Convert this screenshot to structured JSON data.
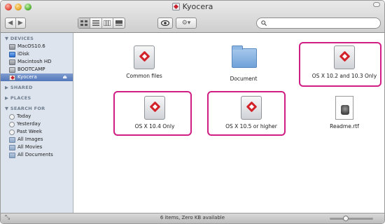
{
  "window": {
    "title": "Kyocera"
  },
  "toolbar": {
    "back_glyph": "◀",
    "forward_glyph": "▶",
    "view_modes": [
      "icon-view",
      "list-view",
      "column-view",
      "coverflow-view"
    ],
    "quick_look_glyph": "👁",
    "action_glyph": "⚙▾",
    "search_placeholder": ""
  },
  "sidebar": {
    "sections": [
      {
        "label": "▼ DEVICES"
      },
      {
        "label": "▶ SHARED"
      },
      {
        "label": "▶ PLACES"
      },
      {
        "label": "▼ SEARCH FOR"
      }
    ],
    "devices": [
      {
        "label": "MacOS10.6",
        "icon": "hard-drive-icon"
      },
      {
        "label": "iDisk",
        "icon": "idisk-icon"
      },
      {
        "label": "Macintosh HD",
        "icon": "hard-drive-icon"
      },
      {
        "label": "BOOTCAMP",
        "icon": "hard-drive-icon"
      },
      {
        "label": "Kyocera",
        "icon": "kyocera-disk-icon",
        "selected": true,
        "eject": "⏏"
      }
    ],
    "search_for": [
      {
        "label": "Today",
        "icon": "clock-icon"
      },
      {
        "label": "Yesterday",
        "icon": "clock-icon"
      },
      {
        "label": "Past Week",
        "icon": "clock-icon"
      },
      {
        "label": "All Images",
        "icon": "smart-folder-icon"
      },
      {
        "label": "All Movies",
        "icon": "smart-folder-icon"
      },
      {
        "label": "All Documents",
        "icon": "smart-folder-icon"
      }
    ]
  },
  "files": [
    {
      "label": "Common files",
      "icon": "kyocera-document-icon",
      "highlighted": false
    },
    {
      "label": "Document",
      "icon": "folder-icon",
      "highlighted": false
    },
    {
      "label": "OS X 10.2 and 10.3 Only",
      "icon": "kyocera-document-icon",
      "highlighted": true
    },
    {
      "label": "OS X 10.4 Only",
      "icon": "kyocera-document-icon",
      "highlighted": true
    },
    {
      "label": "OS X 10.5 or higher",
      "icon": "kyocera-document-icon",
      "highlighted": true
    },
    {
      "label": "Readme.rtf",
      "icon": "rtf-document-icon",
      "highlighted": false
    }
  ],
  "statusbar": {
    "text": "6 items, Zero KB available",
    "zoom_level": 0.35
  },
  "colors": {
    "highlight": "#d11e85",
    "sidebar_bg": "#dde4ed",
    "selection": "#5276b8"
  }
}
